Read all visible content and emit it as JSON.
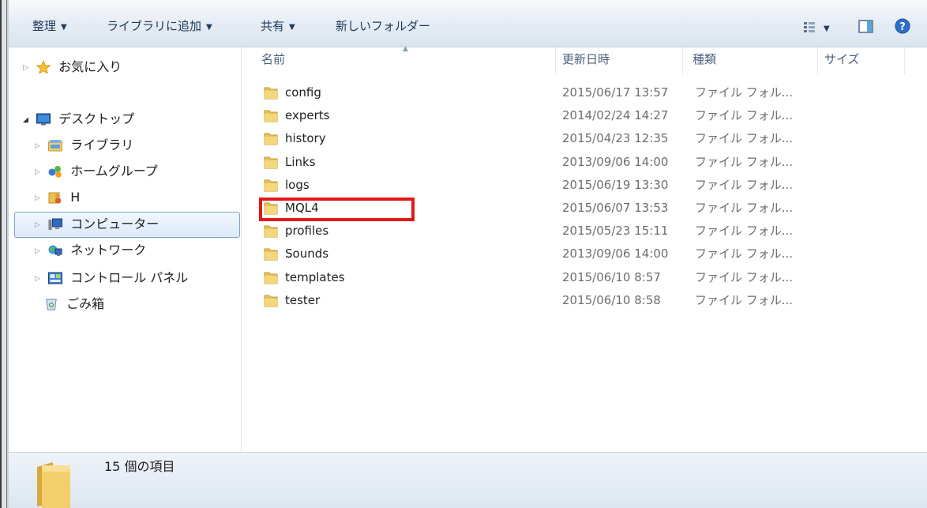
{
  "toolbar": {
    "organize": "整理",
    "add_to_library": "ライブラリに追加",
    "share": "共有",
    "new_folder": "新しいフォルダー"
  },
  "nav": {
    "favorites": "お気に入り",
    "desktop": "デスクトップ",
    "libraries": "ライブラリ",
    "homegroup": "ホームグループ",
    "h_drive": "H",
    "computer": "コンピューター",
    "network": "ネットワーク",
    "control_panel": "コントロール パネル",
    "recycle_bin": "ごみ箱"
  },
  "columns": {
    "name": "名前",
    "modified": "更新日時",
    "type": "種類",
    "size": "サイズ"
  },
  "files": [
    {
      "name": "config",
      "date": "2015/06/17 13:57",
      "type": "ファイル フォル..."
    },
    {
      "name": "experts",
      "date": "2014/02/24 14:27",
      "type": "ファイル フォル..."
    },
    {
      "name": "history",
      "date": "2015/04/23 12:35",
      "type": "ファイル フォル..."
    },
    {
      "name": "Links",
      "date": "2013/09/06 14:00",
      "type": "ファイル フォル..."
    },
    {
      "name": "logs",
      "date": "2015/06/19 13:30",
      "type": "ファイル フォル..."
    },
    {
      "name": "MQL4",
      "date": "2015/06/07 13:53",
      "type": "ファイル フォル..."
    },
    {
      "name": "profiles",
      "date": "2015/05/23 15:11",
      "type": "ファイル フォル..."
    },
    {
      "name": "Sounds",
      "date": "2013/09/06 14:00",
      "type": "ファイル フォル..."
    },
    {
      "name": "templates",
      "date": "2015/06/10 8:57",
      "type": "ファイル フォル..."
    },
    {
      "name": "tester",
      "date": "2015/06/10 8:58",
      "type": "ファイル フォル..."
    }
  ],
  "status": {
    "item_count": "15 個の項目"
  },
  "icons": {
    "favorites": "star-icon",
    "desktop": "desktop-icon",
    "libraries": "library-icon",
    "homegroup": "homegroup-icon",
    "h_drive": "user-folder-icon",
    "computer": "computer-icon",
    "network": "network-icon",
    "control_panel": "control-panel-icon",
    "recycle_bin": "recycle-bin-icon",
    "folder": "folder-icon",
    "view": "view-options-icon",
    "preview": "preview-pane-icon",
    "help": "help-icon"
  },
  "colors": {
    "highlight_box": "#e01818",
    "selection_border": "#7da2ce",
    "folder": "#e8c25a"
  }
}
